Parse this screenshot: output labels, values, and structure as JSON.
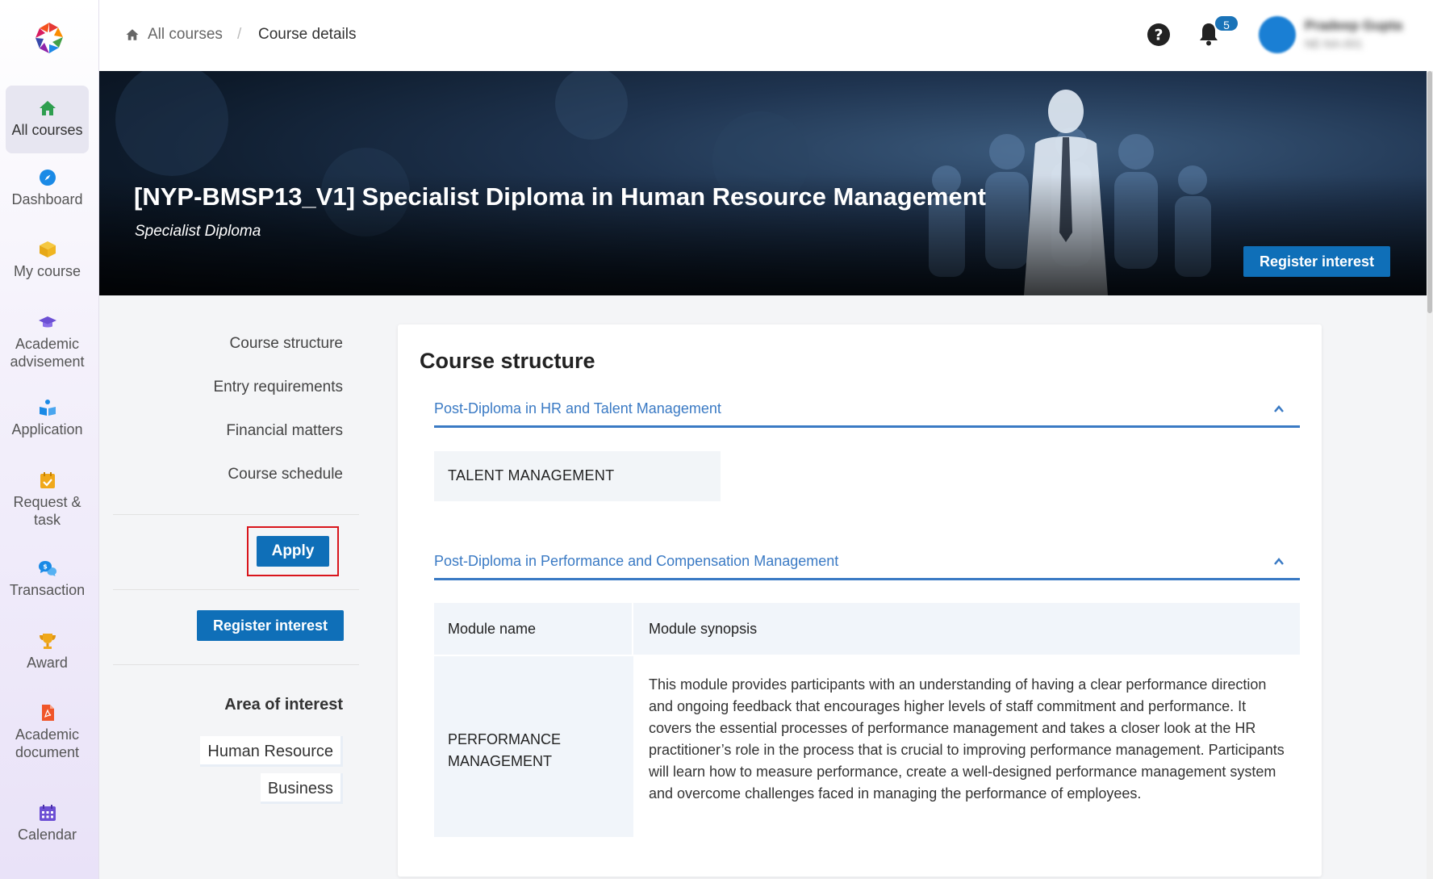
{
  "sidebar": {
    "items": [
      {
        "label": "All courses",
        "icon": "home-icon"
      },
      {
        "label": "Dashboard",
        "icon": "compass-icon"
      },
      {
        "label": "My course",
        "icon": "box-icon"
      },
      {
        "label": "Academic advisement",
        "icon": "graduation-cap-icon"
      },
      {
        "label": "Application",
        "icon": "application-icon"
      },
      {
        "label": "Request & task",
        "icon": "calendar-check-icon"
      },
      {
        "label": "Transaction",
        "icon": "chat-dollar-icon"
      },
      {
        "label": "Award",
        "icon": "trophy-icon"
      },
      {
        "label": "Academic document",
        "icon": "pdf-file-icon"
      },
      {
        "label": "Calendar",
        "icon": "calendar-icon"
      }
    ]
  },
  "header": {
    "breadcrumb_home": "All courses",
    "breadcrumb_sep": "/",
    "breadcrumb_current": "Course details",
    "notification_count": "5",
    "user_name": "Pradeep Gupta",
    "user_sub": "NE-NA-001"
  },
  "hero": {
    "title": "[NYP-BMSP13_V1] Specialist Diploma in Human Resource Management",
    "subtitle": "Specialist Diploma",
    "register_label": "Register interest"
  },
  "left_nav": {
    "links": [
      "Course structure",
      "Entry requirements",
      "Financial matters",
      "Course schedule"
    ],
    "apply_label": "Apply",
    "register_label": "Register interest",
    "area_title": "Area of interest",
    "areas": [
      "Human Resource",
      "Business"
    ]
  },
  "main": {
    "title": "Course structure",
    "sections": [
      {
        "title": "Post-Diploma in HR and Talent Management",
        "modules": [
          "TALENT MANAGEMENT"
        ]
      },
      {
        "title": "Post-Diploma in Performance and Compensation Management"
      }
    ],
    "table": {
      "headers": [
        "Module name",
        "Module synopsis"
      ],
      "rows": [
        {
          "name": "PERFORMANCE MANAGEMENT",
          "synopsis": "This module provides participants with an understanding of having a clear performance direction and ongoing feedback that encourages higher levels of staff commitment and performance. It covers the essential processes of performance management and takes a closer look at the HR practitioner’s role in the process that is crucial to improving performance management. Participants will learn how to measure performance, create a well-designed performance management system and overcome challenges faced in managing the performance of employees."
        }
      ]
    }
  },
  "colors": {
    "primary": "#0f6fb8",
    "accent_link": "#3a7ac4",
    "highlight_frame": "#d9151c"
  }
}
